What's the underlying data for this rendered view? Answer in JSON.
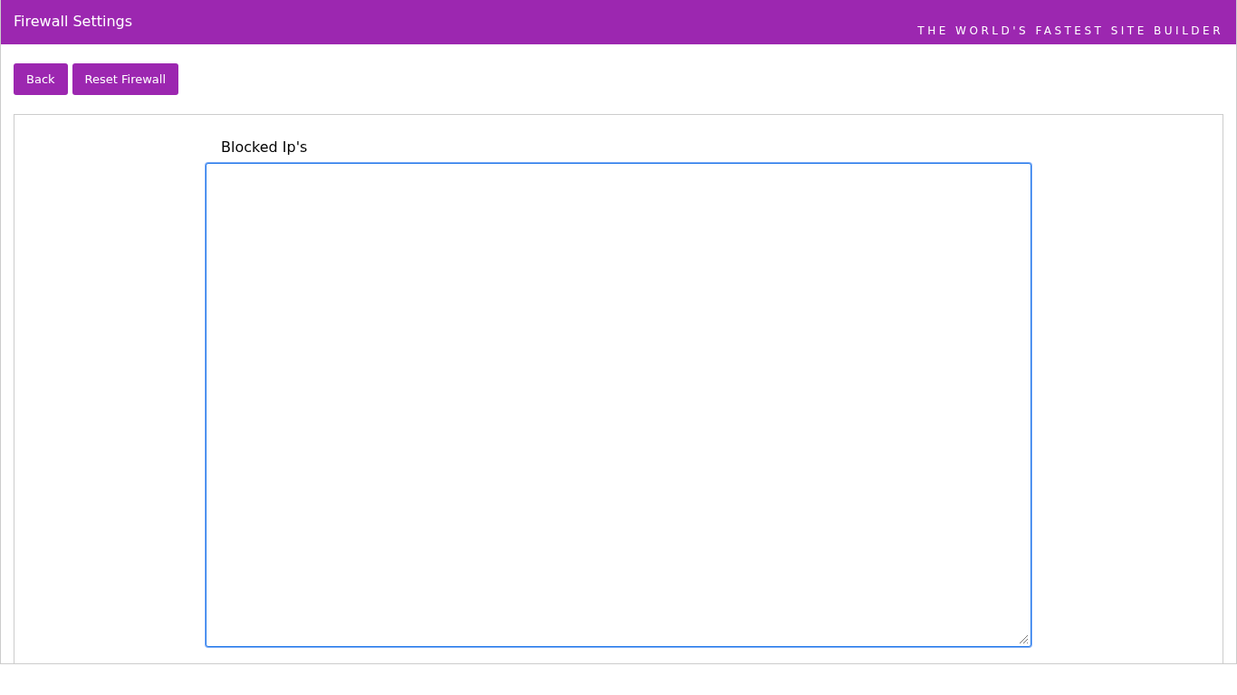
{
  "header": {
    "title": "Firewall Settings",
    "tagline": "THE WORLD'S FASTEST SITE BUILDER"
  },
  "buttons": [
    "Back",
    "Reset Firewall"
  ],
  "blocked_ips": {
    "label": "Blocked Ip's",
    "focused": true
  }
}
